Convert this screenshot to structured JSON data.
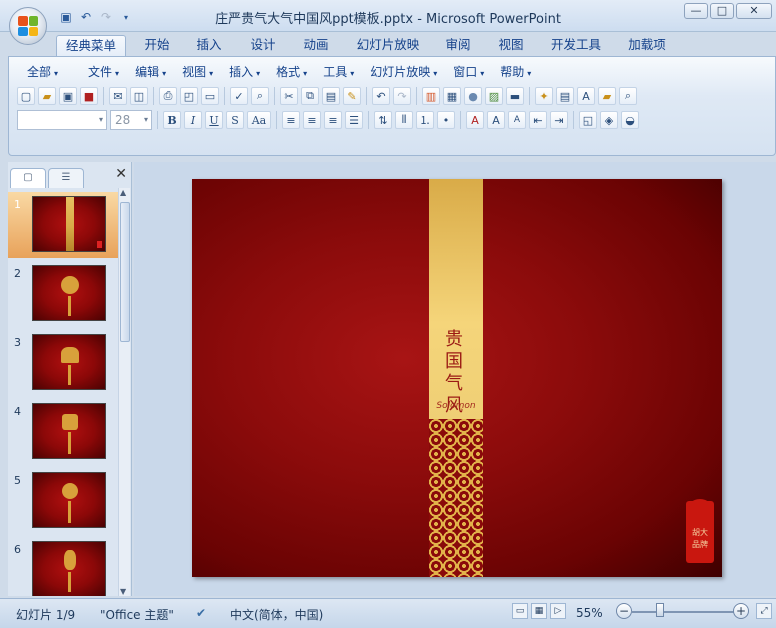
{
  "window": {
    "title": "庄严贵气大气中国风ppt模板.pptx - Microsoft PowerPoint",
    "minimize": "—",
    "maximize": "□",
    "close": "✕"
  },
  "ribbon_tabs": [
    "经典菜单",
    "开始",
    "插入",
    "设计",
    "动画",
    "幻灯片放映",
    "审阅",
    "视图",
    "开发工具",
    "加载项"
  ],
  "classic_menu": [
    "全部",
    "文件",
    "编辑",
    "视图",
    "插入",
    "格式",
    "工具",
    "幻灯片放映",
    "窗口",
    "帮助"
  ],
  "font": {
    "name_value": "",
    "size_value": "28"
  },
  "format_buttons": {
    "bold": "B",
    "italic": "I",
    "underline": "U",
    "shadow": "S",
    "case": "Aa"
  },
  "thumbnails": [
    {
      "num": "1"
    },
    {
      "num": "2"
    },
    {
      "num": "3"
    },
    {
      "num": "4"
    },
    {
      "num": "5"
    },
    {
      "num": "6"
    }
  ],
  "slide": {
    "seal_text": "贵国\n气风",
    "signature": "Solomon",
    "stamp_text": "胡大\n品牌"
  },
  "status": {
    "slide_indicator": "幻灯片 1/9",
    "theme": "\"Office 主题\"",
    "language": "中文(简体，中国)",
    "zoom": "55%"
  },
  "colors": {
    "slide_red": "#8b0b0b",
    "band_gold": "#f5d57a",
    "ribbon_blue": "#15428b"
  }
}
